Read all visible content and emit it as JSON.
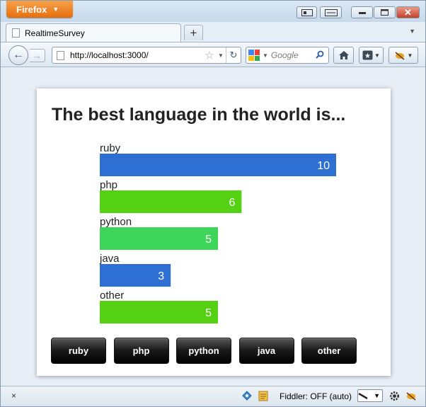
{
  "browser": {
    "app_button": "Firefox",
    "tab_title": "RealtimeSurvey",
    "new_tab": "+",
    "url": "http://localhost:3000/",
    "search_placeholder": "Google",
    "status_fiddler": "Fiddler: OFF (auto)",
    "status_close": "×"
  },
  "survey": {
    "heading": "The best language in the world is...",
    "vote_buttons": [
      "ruby",
      "php",
      "python",
      "java",
      "other"
    ]
  },
  "chart_data": {
    "type": "bar",
    "orientation": "horizontal",
    "categories": [
      "ruby",
      "php",
      "python",
      "java",
      "other"
    ],
    "values": [
      10,
      6,
      5,
      3,
      5
    ],
    "colors": [
      "#2e6fd3",
      "#55d113",
      "#3ed65a",
      "#2e6fd3",
      "#55d113"
    ],
    "data_labels": true
  }
}
